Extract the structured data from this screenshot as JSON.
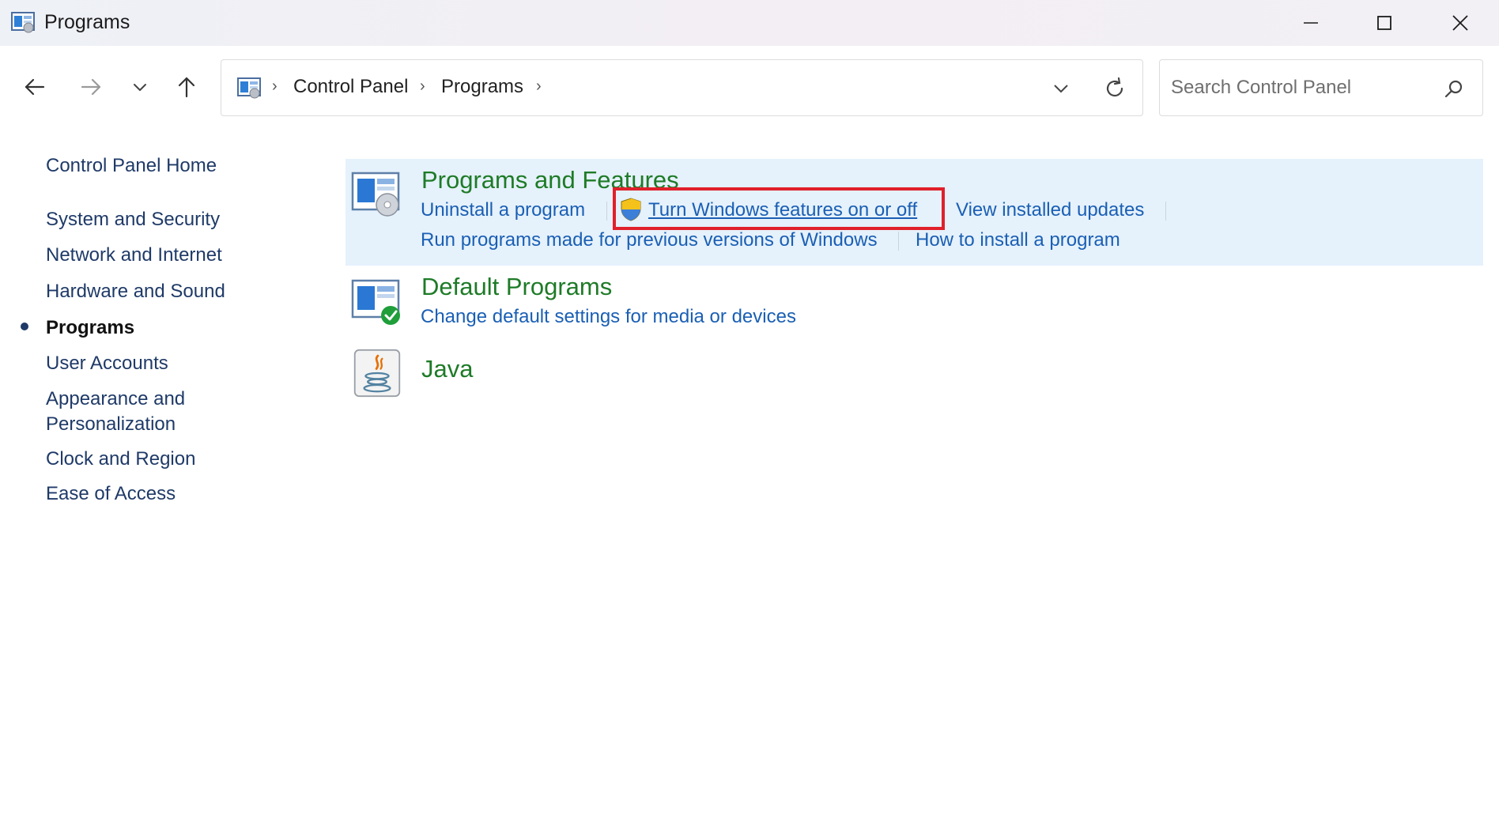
{
  "window": {
    "title": "Programs"
  },
  "address_bar": {
    "breadcrumbs": [
      "Control Panel",
      "Programs"
    ],
    "separator": "›"
  },
  "search": {
    "placeholder": "Search Control Panel"
  },
  "left_nav": {
    "home": "Control Panel Home",
    "items": [
      "System and Security",
      "Network and Internet",
      "Hardware and Sound",
      "Programs",
      "User Accounts",
      "Appearance and",
      "Personalization",
      "Clock and Region",
      "Ease of Access"
    ],
    "current_index": 3
  },
  "categories": {
    "programs_and_features": {
      "title": "Programs and Features",
      "links": [
        "Uninstall a program",
        "Turn Windows features on or off",
        "View installed updates",
        "Run programs made for previous versions of Windows",
        "How to install a program"
      ]
    },
    "default_programs": {
      "title": "Default Programs",
      "links": [
        "Change default settings for media or devices"
      ]
    },
    "java": {
      "title": "Java"
    }
  },
  "colors": {
    "category_title": "#1e7b27",
    "link": "#1a5fb4",
    "highlight_bg": "#e5f1fb",
    "annotation_box": "#e0202a",
    "nav_text": "#1f3a68"
  },
  "icons": {
    "app": "control-panel-icon",
    "programs_features": "programs-features-icon",
    "default_programs": "default-programs-icon",
    "java": "java-icon",
    "shield": "uac-shield-icon"
  }
}
